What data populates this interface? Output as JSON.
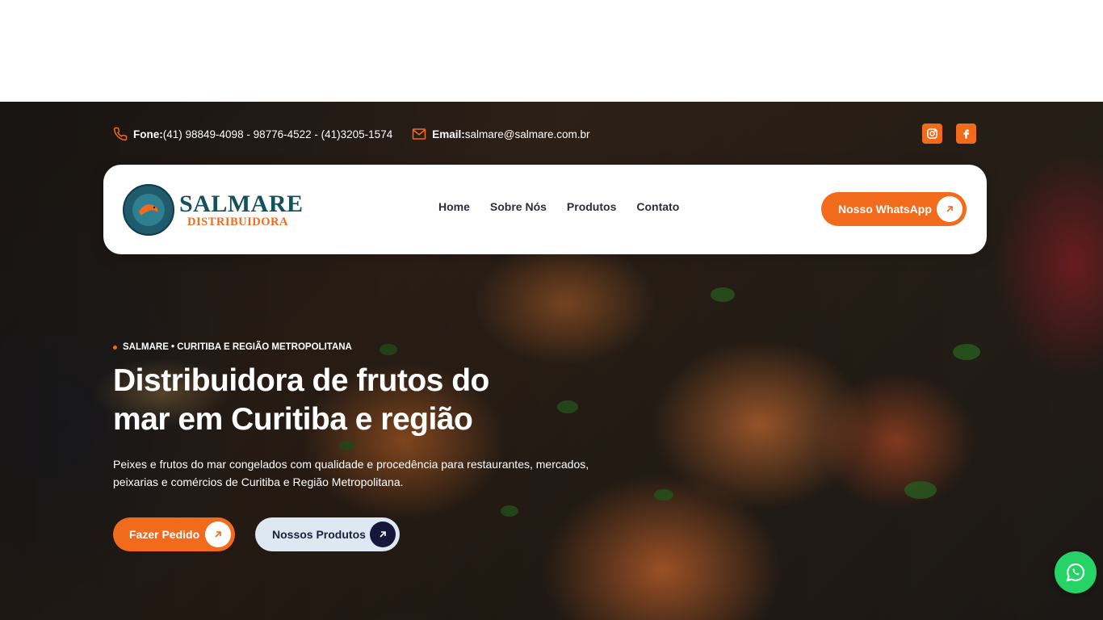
{
  "topbar": {
    "phone_label": "Fone:",
    "phone_value": " (41) 98849-4098 - 98776-4522 - (41)3205-1574",
    "email_label": "Email:",
    "email_value": "salmare@salmare.com.br",
    "social": [
      "instagram-icon",
      "facebook-icon"
    ]
  },
  "logo": {
    "name": "SALMARE",
    "subtitle": "DISTRIBUIDORA",
    "badge_text": "SALMARE"
  },
  "nav": {
    "items": [
      {
        "label": "Home"
      },
      {
        "label": "Sobre Nós"
      },
      {
        "label": "Produtos"
      },
      {
        "label": "Contato"
      }
    ],
    "cta_label": "Nosso WhatsApp"
  },
  "hero": {
    "eyebrow": "SALMARE • CURITIBA E REGIÃO METROPOLITANA",
    "headline_line1": "Distribuidora de frutos do",
    "headline_line2": "mar em Curitiba e região",
    "description": "Peixes e frutos do mar congelados com qualidade e procedência para restaurantes, mercados, peixarias e comércios de Curitiba e Região Metropolitana.",
    "primary_button": "Fazer Pedido",
    "secondary_button": "Nossos Produtos"
  },
  "colors": {
    "accent": "#f26b1d",
    "navy": "#15173a",
    "brand_teal": "#14505e",
    "whatsapp": "#25d366"
  }
}
